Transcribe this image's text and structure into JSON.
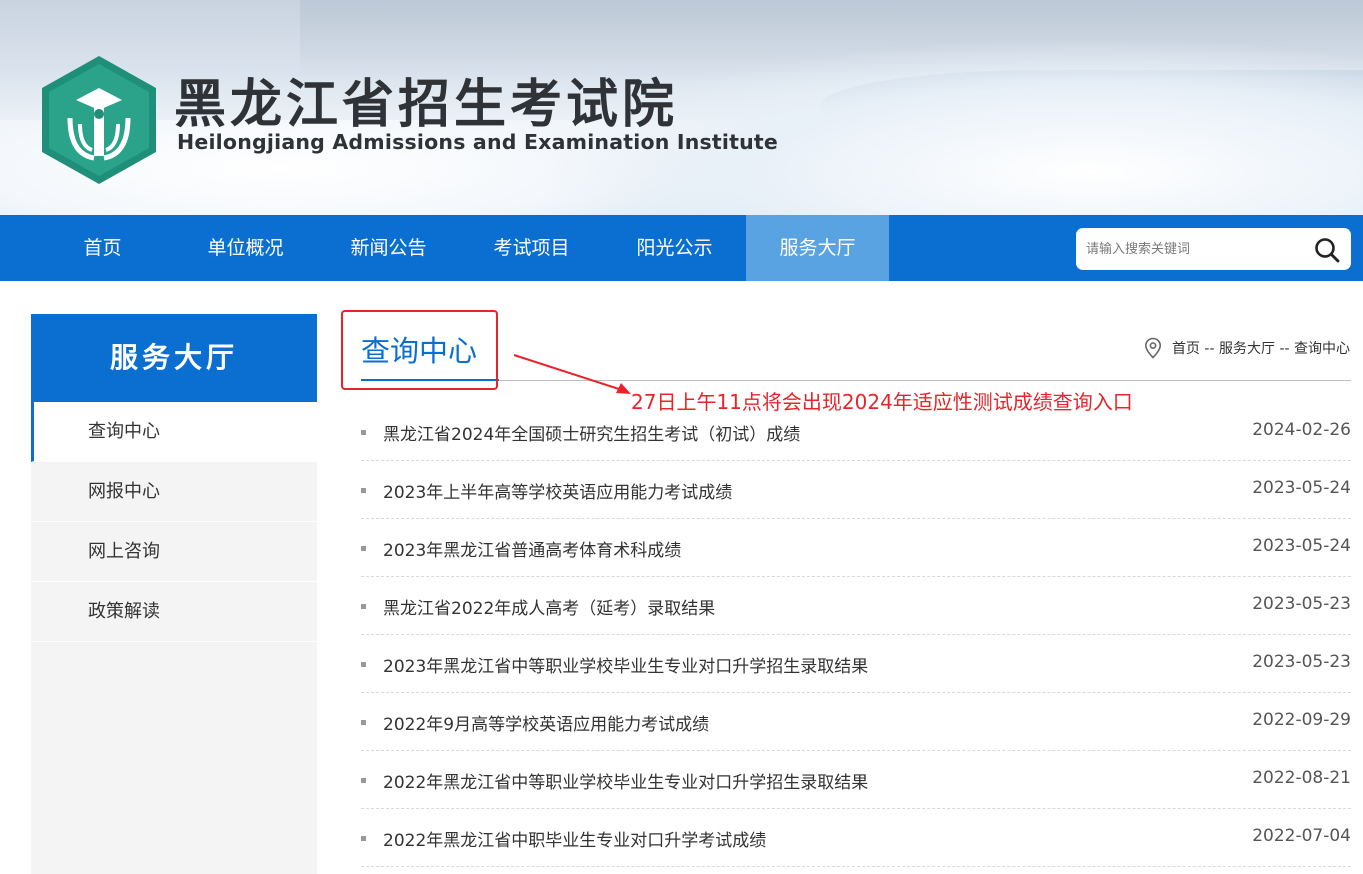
{
  "header": {
    "site_name_cn": "黑龙江省招生考试院",
    "site_name_en": "Heilongjiang Admissions and Examination Institute",
    "logo_icon": "institute-emblem-icon"
  },
  "nav": {
    "items": [
      {
        "label": "首页"
      },
      {
        "label": "单位概况"
      },
      {
        "label": "新闻公告"
      },
      {
        "label": "考试项目"
      },
      {
        "label": "阳光公示"
      },
      {
        "label": "服务大厅",
        "active": true
      }
    ],
    "search_placeholder": "请输入搜索关键词",
    "search_icon": "search-icon"
  },
  "sidebar": {
    "heading": "服务大厅",
    "items": [
      {
        "label": "查询中心",
        "active": true
      },
      {
        "label": "网报中心"
      },
      {
        "label": "网上咨询"
      },
      {
        "label": "政策解读"
      }
    ]
  },
  "main": {
    "title": "查询中心",
    "breadcrumb": "首页 -- 服务大厅 -- 查询中心",
    "annotation": "27日上午11点将会出现2024年适应性测试成绩查询入口",
    "items": [
      {
        "title": "黑龙江省2024年全国硕士研究生招生考试（初试）成绩",
        "date": "2024-02-26"
      },
      {
        "title": "2023年上半年高等学校英语应用能力考试成绩",
        "date": "2023-05-24"
      },
      {
        "title": "2023年黑龙江省普通高考体育术科成绩",
        "date": "2023-05-24"
      },
      {
        "title": "黑龙江省2022年成人高考（延考）录取结果",
        "date": "2023-05-23"
      },
      {
        "title": "2023年黑龙江省中等职业学校毕业生专业对口升学招生录取结果",
        "date": "2023-05-23"
      },
      {
        "title": "2022年9月高等学校英语应用能力考试成绩",
        "date": "2022-09-29"
      },
      {
        "title": "2022年黑龙江省中等职业学校毕业生专业对口升学招生录取结果",
        "date": "2022-08-21"
      },
      {
        "title": "2022年黑龙江省中职毕业生专业对口升学考试成绩",
        "date": "2022-07-04"
      }
    ]
  },
  "colors": {
    "primary": "#0a6fd1",
    "nav_active": "#5aa3e2",
    "annotation_red": "#e8242a"
  }
}
